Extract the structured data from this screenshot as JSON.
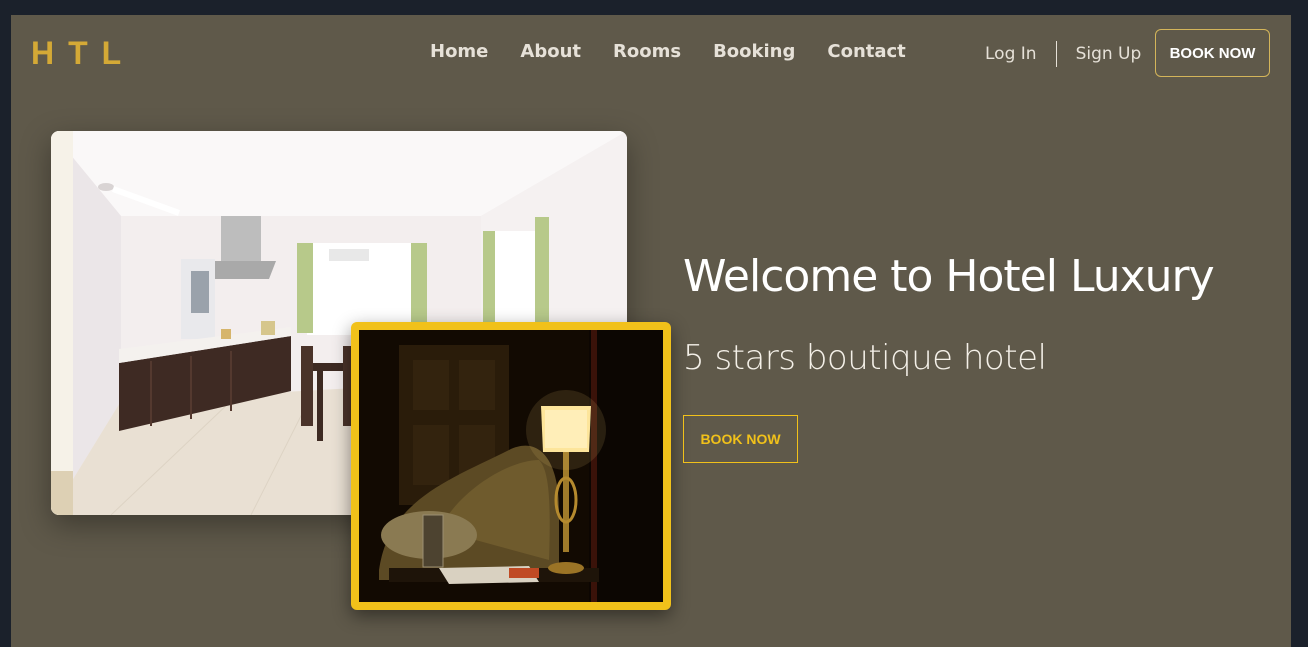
{
  "brand": {
    "logo": "HTL"
  },
  "nav": {
    "links": [
      "Home",
      "About",
      "Rooms",
      "Booking",
      "Contact"
    ],
    "login": "Log In",
    "signup": "Sign Up",
    "book_now": "BOOK NOW"
  },
  "hero": {
    "title": "Welcome to Hotel Luxury",
    "subtitle": "5 stars boutique hotel",
    "cta": "BOOK NOW",
    "images": [
      "kitchen-photo",
      "bedroom-lamp-photo"
    ]
  },
  "colors": {
    "background": "#5f594a",
    "frame": "#1b212b",
    "accent": "#f1c11a",
    "logo": "#d4a936",
    "text": "#ffffff"
  }
}
